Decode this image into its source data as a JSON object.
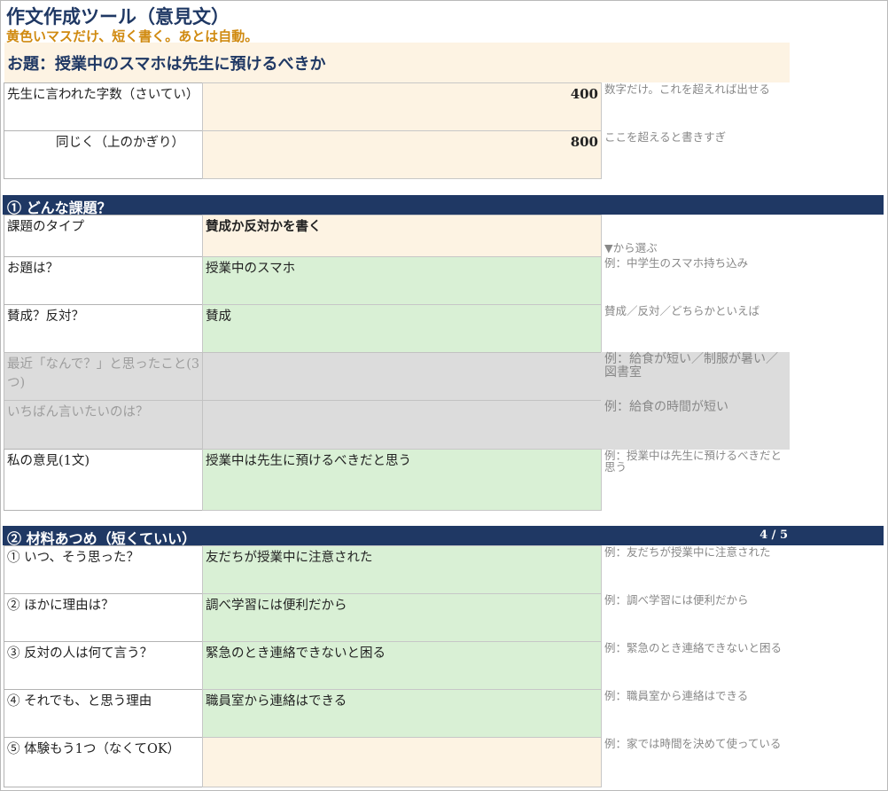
{
  "title": "作文作成ツール（意見文）",
  "subtitle": "黄色いマスだけ、短く書く。あとは自動。",
  "topic": "お題：授業中のスマホは先生に預けるべきか",
  "word_count": {
    "min_label": "先生に言われた字数（さいてい）",
    "min_value": "400",
    "min_hint": "数字だけ。これを超えれば出せる",
    "max_label": "同じく（上のかぎり）",
    "max_value": "800",
    "max_hint": "ここを超えると書きすぎ"
  },
  "section1": {
    "header": "① どんな課題？",
    "rows": [
      {
        "label": "課題のタイプ",
        "value": "賛成か反対かを書く",
        "hint": "▼から選ぶ"
      },
      {
        "label": "お題は？",
        "value": "授業中のスマホ",
        "hint": "例：中学生のスマホ持ち込み"
      },
      {
        "label": "賛成？反対？",
        "value": "賛成",
        "hint": "賛成／反対／どちらかといえば"
      },
      {
        "label": "最近「なんで？」と思ったこと(3つ)",
        "value": "",
        "hint": "例：給食が短い／制服が暑い／図書室"
      },
      {
        "label": "いちばん言いたいのは？",
        "value": "",
        "hint": "例：給食の時間が短い"
      },
      {
        "label": "私の意見(1文)",
        "value": "授業中は先生に預けるべきだと思う",
        "hint": "例：授業中は先生に預けるべきだと思う"
      }
    ]
  },
  "section2": {
    "header": "② 材料あつめ（短くていい）",
    "progress": "4 / 5",
    "rows": [
      {
        "label": "① いつ、そう思った？",
        "value": "友だちが授業中に注意された",
        "hint": "例：友だちが授業中に注意された"
      },
      {
        "label": "② ほかに理由は？",
        "value": "調べ学習には便利だから",
        "hint": "例：調べ学習には便利だから"
      },
      {
        "label": "③ 反対の人は何て言う？",
        "value": "緊急のとき連絡できないと困る",
        "hint": "例：緊急のとき連絡できないと困る"
      },
      {
        "label": "④ それでも、と思う理由",
        "value": "職員室から連絡はできる",
        "hint": "例：職員室から連絡はできる"
      },
      {
        "label": "⑤ 体験もう1つ（なくてOK）",
        "value": "",
        "hint": "例：家では時間を決めて使っている"
      }
    ]
  },
  "colors": {
    "navy": "#1f3864",
    "orange": "#d08a10",
    "cream": "#fdf3e3",
    "green": "#d9f0d5",
    "gray": "#dcdcdc"
  }
}
